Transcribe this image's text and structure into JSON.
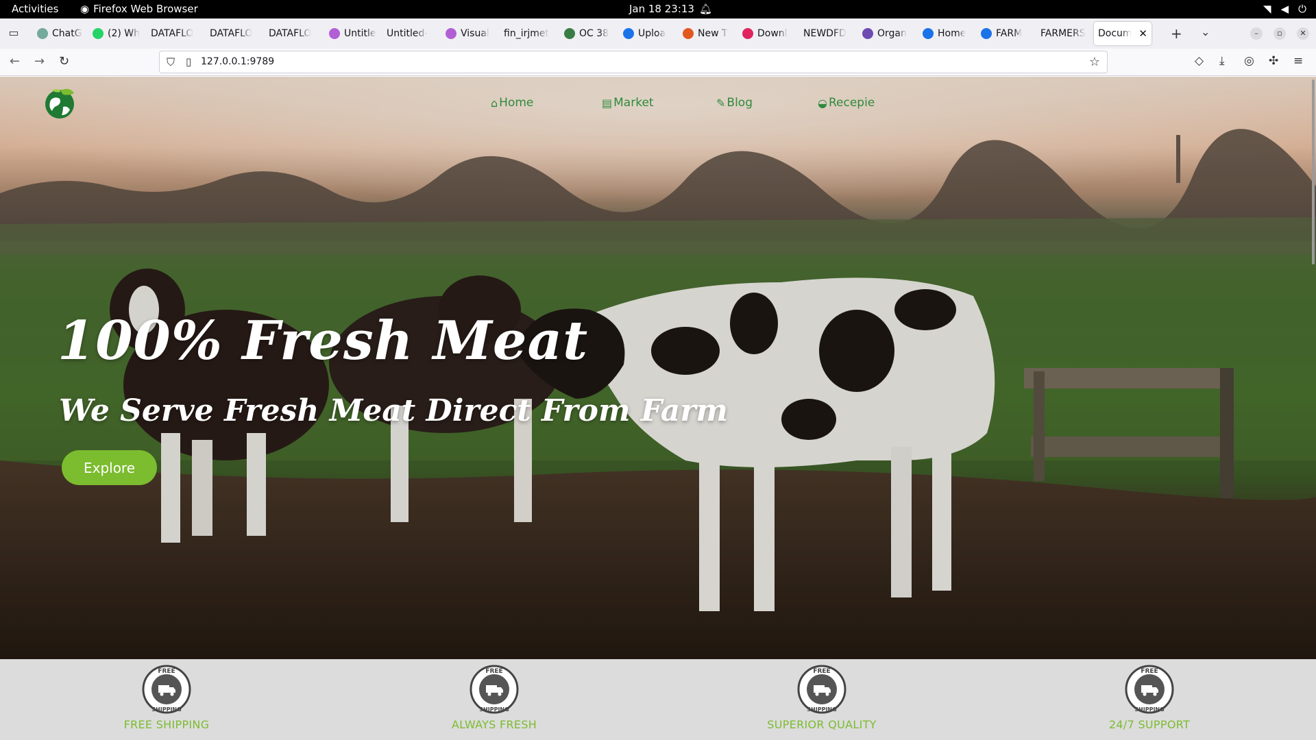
{
  "system": {
    "activities": "Activities",
    "app_name": "Firefox Web Browser",
    "clock": "Jan 18  23:13"
  },
  "browser": {
    "tabs": [
      {
        "label": "ChatG",
        "color": "#74aa9c"
      },
      {
        "label": "(2) Wh",
        "color": "#25d366"
      },
      {
        "label": "DATAFLO",
        "color": ""
      },
      {
        "label": "DATAFLO",
        "color": ""
      },
      {
        "label": "DATAFLO",
        "color": ""
      },
      {
        "label": "Untitle",
        "color": "#b25fd6"
      },
      {
        "label": "Untitled-",
        "color": ""
      },
      {
        "label": "Visual",
        "color": "#b25fd6"
      },
      {
        "label": "fin_irjmet",
        "color": ""
      },
      {
        "label": "OC 38",
        "color": "#3a7d44"
      },
      {
        "label": "Uploa",
        "color": "#1a73e8"
      },
      {
        "label": "New T",
        "color": "#e25920"
      },
      {
        "label": "Downl",
        "color": "#e0245e"
      },
      {
        "label": "NEWDFD",
        "color": ""
      },
      {
        "label": "Organ",
        "color": "#6e4ab3"
      },
      {
        "label": "Home",
        "color": "#1a73e8"
      },
      {
        "label": "FARM",
        "color": "#1a73e8"
      },
      {
        "label": "FARMERS",
        "color": ""
      },
      {
        "label": "Docum",
        "color": "",
        "active": true
      }
    ],
    "url": "127.0.0.1:9789"
  },
  "site": {
    "nav": {
      "home": "Home",
      "market": "Market",
      "blog": "Blog",
      "recipe": "Recepie"
    },
    "hero": {
      "headline": "100% Fresh Meat",
      "subline": "We Serve Fresh Meat Direct From Farm",
      "cta": "Explore"
    },
    "features": [
      {
        "label": "FREE SHIPPING",
        "badge_top": "FREE",
        "badge_bottom": "SHIPPING"
      },
      {
        "label": "ALWAYS FRESH",
        "badge_top": "FREE",
        "badge_bottom": "SHIPPING"
      },
      {
        "label": "SUPERIOR QUALITY",
        "badge_top": "FREE",
        "badge_bottom": "SHIPPING"
      },
      {
        "label": "24/7 SUPPORT",
        "badge_top": "FREE",
        "badge_bottom": "SHIPPING"
      }
    ],
    "accent_color": "#7cbc2f",
    "nav_color": "#2f8a3c"
  }
}
